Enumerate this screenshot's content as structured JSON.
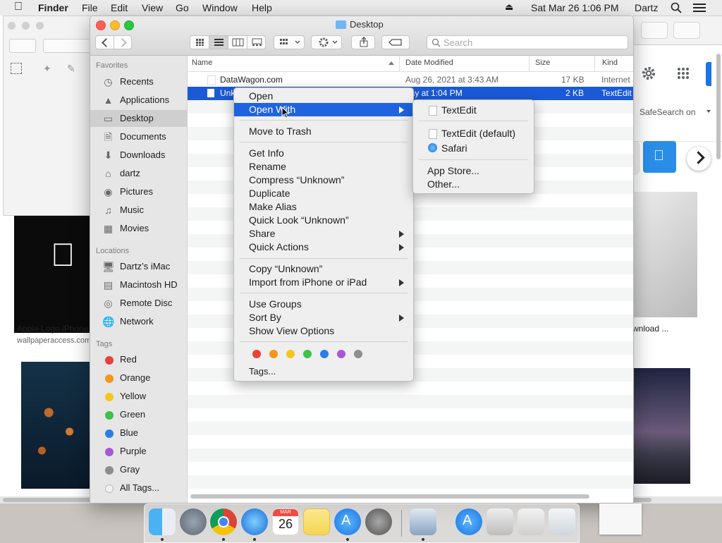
{
  "menubar": {
    "app_name": "Finder",
    "items": [
      "File",
      "Edit",
      "View",
      "Go",
      "Window",
      "Help"
    ],
    "datetime": "Sat Mar 26  1:06 PM",
    "user": "Dartz"
  },
  "background_safari": {
    "safesearch_label": "SafeSearch on",
    "result_left_title": "Apple Logo iPhone",
    "result_left_source": "wallpaperaccess.com",
    "result_right_title": "wnload ..."
  },
  "finder": {
    "window_title": "Desktop",
    "search_placeholder": "Search",
    "sidebar": {
      "favorites_header": "Favorites",
      "favorites": [
        {
          "label": "Recents",
          "icon": "clock-icon"
        },
        {
          "label": "Applications",
          "icon": "applications-icon"
        },
        {
          "label": "Desktop",
          "icon": "desktop-icon"
        },
        {
          "label": "Documents",
          "icon": "document-icon"
        },
        {
          "label": "Downloads",
          "icon": "download-icon"
        },
        {
          "label": "dartz",
          "icon": "home-icon"
        },
        {
          "label": "Pictures",
          "icon": "camera-icon"
        },
        {
          "label": "Music",
          "icon": "music-icon"
        },
        {
          "label": "Movies",
          "icon": "film-icon"
        }
      ],
      "locations_header": "Locations",
      "locations": [
        {
          "label": "Dartz’s iMac",
          "icon": "imac-icon"
        },
        {
          "label": "Macintosh HD",
          "icon": "disk-icon"
        },
        {
          "label": "Remote Disc",
          "icon": "disc-icon"
        },
        {
          "label": "Network",
          "icon": "globe-icon"
        }
      ],
      "tags_header": "Tags",
      "tags": [
        {
          "label": "Red",
          "color": "#e8403b"
        },
        {
          "label": "Orange",
          "color": "#f5951d"
        },
        {
          "label": "Yellow",
          "color": "#f5c51d"
        },
        {
          "label": "Green",
          "color": "#3fc14a"
        },
        {
          "label": "Blue",
          "color": "#2b7de8"
        },
        {
          "label": "Purple",
          "color": "#a957d6"
        },
        {
          "label": "Gray",
          "color": "#8e8e8e"
        },
        {
          "label": "All Tags...",
          "color": "#dcdcdc"
        }
      ]
    },
    "columns": {
      "name": "Name",
      "date": "Date Modified",
      "size": "Size",
      "kind": "Kind"
    },
    "files": [
      {
        "name": "DataWagon.com",
        "date": "Aug 26, 2021 at 3:43 AM",
        "size": "17 KB",
        "kind": "Internet"
      },
      {
        "name": "Unk",
        "date": "day at 1:04 PM",
        "size": "2 KB",
        "kind": "TextEdit"
      }
    ]
  },
  "context_menu": {
    "open": "Open",
    "open_with": "Open With",
    "move_to_trash": "Move to Trash",
    "get_info": "Get Info",
    "rename": "Rename",
    "compress": "Compress “Unknown”",
    "duplicate": "Duplicate",
    "make_alias": "Make Alias",
    "quick_look": "Quick Look “Unknown”",
    "share": "Share",
    "quick_actions": "Quick Actions",
    "copy": "Copy “Unknown”",
    "import": "Import from iPhone or iPad",
    "use_groups": "Use Groups",
    "sort_by": "Sort By",
    "show_view_options": "Show View Options",
    "tag_colors": [
      "#e8403b",
      "#f5951d",
      "#f5c51d",
      "#3fc14a",
      "#2b7de8",
      "#a957d6",
      "#8e8e8e"
    ],
    "tags": "Tags..."
  },
  "open_with_submenu": {
    "textedit": "TextEdit",
    "textedit_default": "TextEdit (default)",
    "safari": "Safari",
    "app_store": "App Store...",
    "other": "Other..."
  },
  "dock": {
    "calendar_month": "MAR",
    "calendar_day": "26"
  }
}
